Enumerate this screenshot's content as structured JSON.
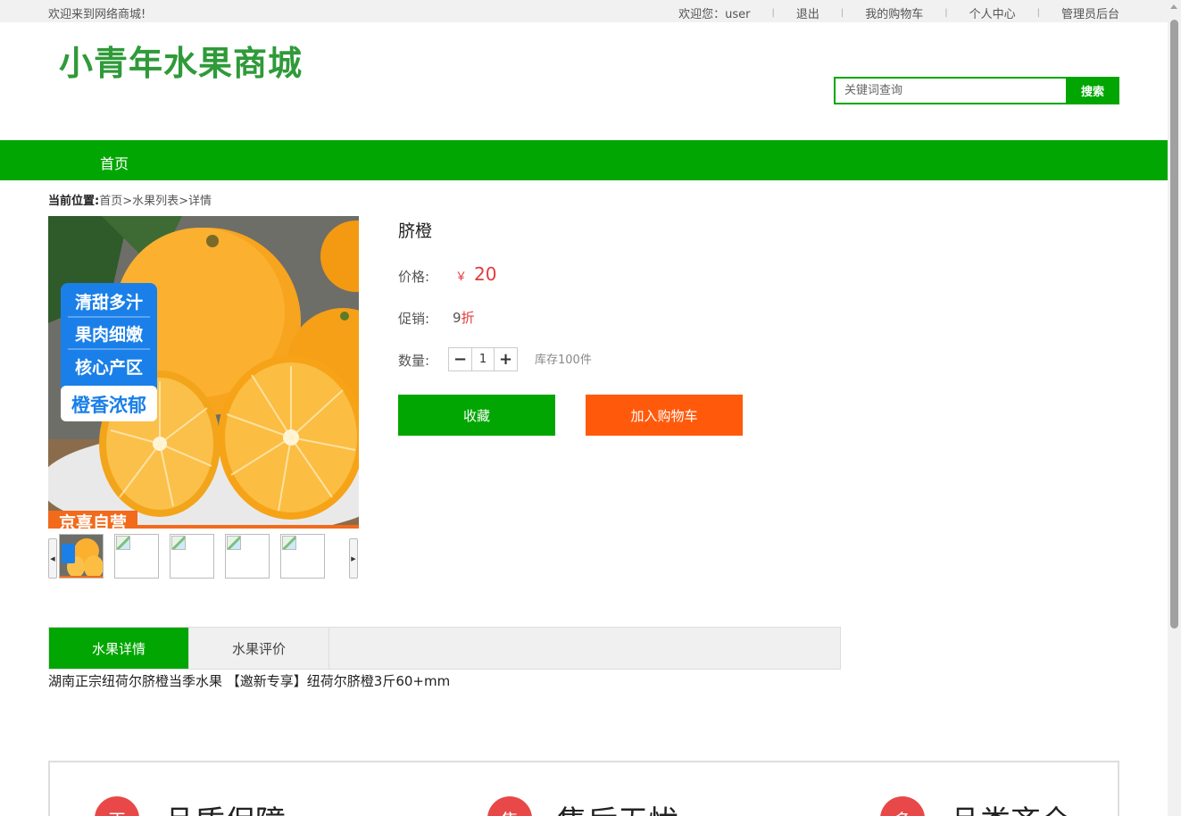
{
  "topbar": {
    "welcome": "欢迎来到网络商城!",
    "user_greeting": "欢迎您：user",
    "logout": "退出",
    "cart": "我的购物车",
    "profile": "个人中心",
    "admin": "管理员后台"
  },
  "logo": "小青年水果商城",
  "search": {
    "placeholder": "关键词查询",
    "button": "搜索"
  },
  "nav": {
    "home": "首页"
  },
  "breadcrumb": {
    "label": "当前位置:",
    "home": "首页",
    "list": "水果列表",
    "detail": "详情",
    "sep": ">"
  },
  "product": {
    "name": "脐橙",
    "price_label": "价格:",
    "currency": "￥",
    "price": "20",
    "promo_label": "促销:",
    "promo_num": "9",
    "promo_unit": "折",
    "qty_label": "数量:",
    "qty": "1",
    "qty_minus": "−",
    "qty_plus": "+",
    "stock": "库存100件",
    "image_tags": [
      "清甜多汁",
      "果肉细嫩",
      "核心产区",
      "橙香浓郁"
    ],
    "image_banner": "京喜自营"
  },
  "actions": {
    "favorite": "收藏",
    "add_cart": "加入购物车"
  },
  "tabs": [
    "水果详情",
    "水果评价"
  ],
  "description": "湖南正宗纽荷尔脐橙当季水果 【邀新专享】纽荷尔脐橙3斤60+mm",
  "features": [
    {
      "icon": "正",
      "label": "品质保障"
    },
    {
      "icon": "售",
      "label": "售后无忧"
    },
    {
      "icon": "多",
      "label": "品类齐全"
    }
  ],
  "colors": {
    "primary": "#02a602",
    "accent": "#ff5a0c",
    "price": "#e4393c"
  }
}
